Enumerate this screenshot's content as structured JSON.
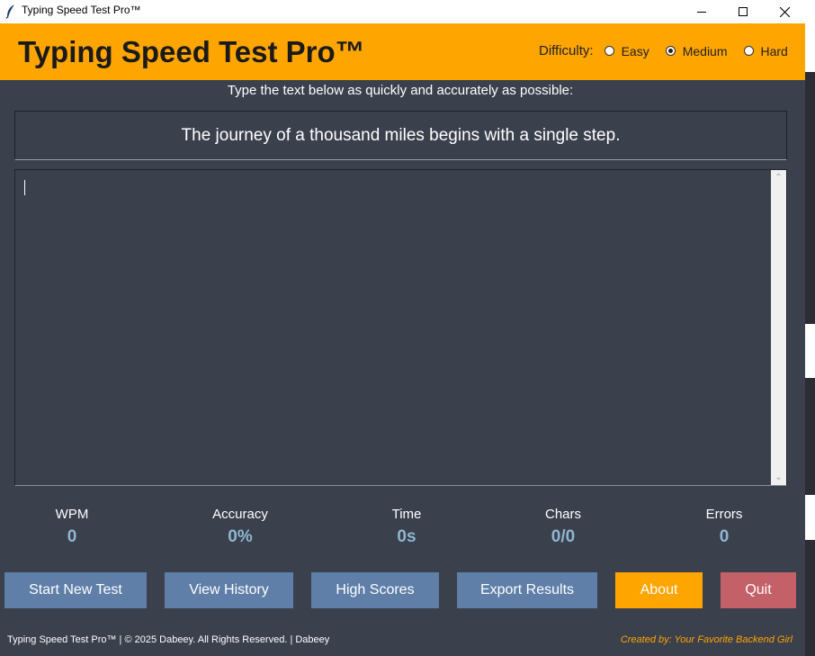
{
  "window": {
    "title": "Typing Speed Test Pro™"
  },
  "header": {
    "title": "Typing Speed Test Pro™",
    "difficulty_label": "Difficulty:",
    "options": [
      {
        "label": "Easy",
        "selected": false
      },
      {
        "label": "Medium",
        "selected": true
      },
      {
        "label": "Hard",
        "selected": false
      }
    ]
  },
  "instruction": "Type the text below as quickly and accurately as possible:",
  "prompt_text": "The journey of a thousand miles begins with a single step.",
  "input_value": "",
  "stats": [
    {
      "label": "WPM",
      "value": "0"
    },
    {
      "label": "Accuracy",
      "value": "0%"
    },
    {
      "label": "Time",
      "value": "0s"
    },
    {
      "label": "Chars",
      "value": "0/0"
    },
    {
      "label": "Errors",
      "value": "0"
    }
  ],
  "buttons": {
    "start": "Start New Test",
    "history": "View History",
    "high_scores": "High Scores",
    "export": "Export Results",
    "about": "About",
    "quit": "Quit"
  },
  "footer": {
    "left": "Typing Speed Test Pro™ | © 2025 Dabeey. All Rights Reserved. | Dabeey",
    "right": "Created by: Your Favorite Backend Girl"
  },
  "colors": {
    "header": "#ffa500",
    "background": "#3a404c",
    "button_blue": "#5f7fa8",
    "button_orange": "#ffa500",
    "button_red": "#c46068",
    "stat_value": "#8fb6d0"
  }
}
